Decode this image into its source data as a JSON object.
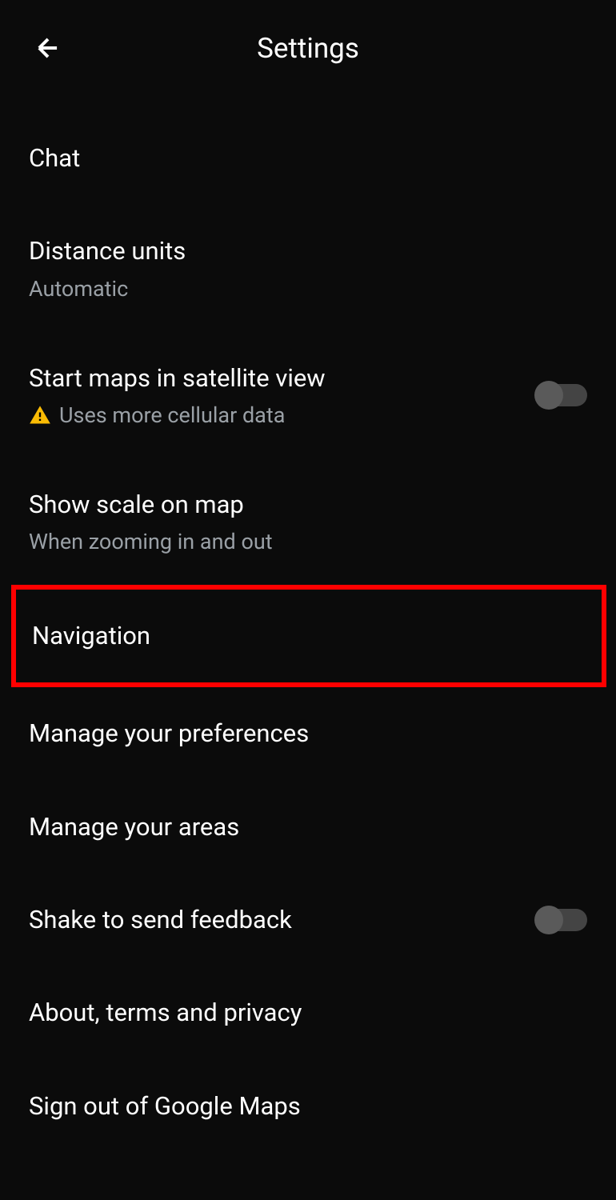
{
  "header": {
    "title": "Settings"
  },
  "settings": {
    "chat": {
      "title": "Chat"
    },
    "distance_units": {
      "title": "Distance units",
      "subtitle": "Automatic"
    },
    "satellite_view": {
      "title": "Start maps in satellite view",
      "subtitle": "Uses more cellular data",
      "toggle": false
    },
    "scale_on_map": {
      "title": "Show scale on map",
      "subtitle": "When zooming in and out"
    },
    "navigation": {
      "title": "Navigation"
    },
    "manage_preferences": {
      "title": "Manage your preferences"
    },
    "manage_areas": {
      "title": "Manage your areas"
    },
    "shake_feedback": {
      "title": "Shake to send feedback",
      "toggle": false
    },
    "about": {
      "title": "About, terms and privacy"
    },
    "sign_out": {
      "title": "Sign out of Google Maps"
    }
  }
}
